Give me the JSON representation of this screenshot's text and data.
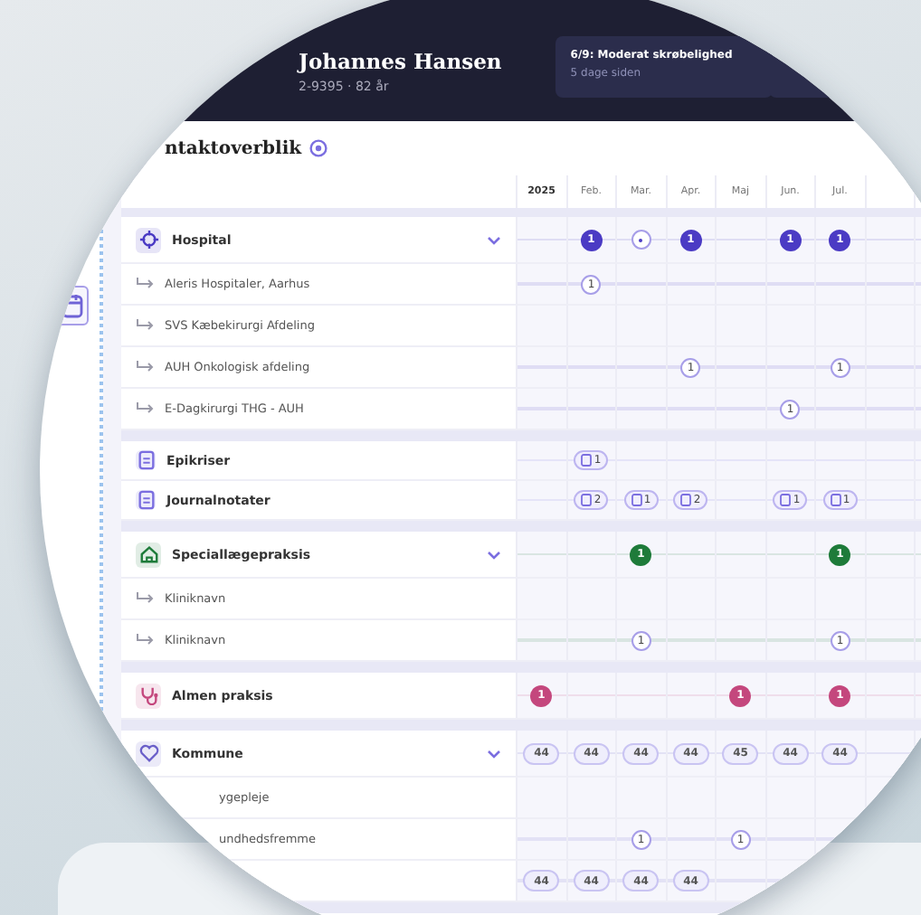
{
  "patient": {
    "name": "Johannes Hansen",
    "details": "2-9395 · 82 år"
  },
  "alert": {
    "title": "6/9: Moderat skrøbelighed",
    "subtitle": "5 dage siden"
  },
  "overview": {
    "title": "ntaktoverblik"
  },
  "months": [
    "2025",
    "Feb.",
    "Mar.",
    "Apr.",
    "Maj",
    "Jun.",
    "Jul."
  ],
  "sections": [
    {
      "color": "#4b3bc4",
      "rows": [
        {
          "kind": "group",
          "label": "Hospital",
          "expanded": true,
          "cells": [
            null,
            {
              "kind": "filled",
              "text": "1"
            },
            {
              "kind": "dot"
            },
            {
              "kind": "filled",
              "text": "1"
            },
            null,
            {
              "kind": "filled",
              "text": "1"
            },
            {
              "kind": "filled",
              "text": "1"
            }
          ]
        },
        {
          "kind": "sub",
          "label": "Aleris Hospitaler, Aarhus",
          "cells": [
            null,
            {
              "kind": "outline",
              "text": "1"
            },
            null,
            null,
            null,
            null,
            null
          ]
        },
        {
          "kind": "sub",
          "label": "SVS Kæbekirurgi Afdeling",
          "cells": []
        },
        {
          "kind": "sub",
          "label": "AUH Onkologisk afdeling",
          "cells": [
            null,
            null,
            null,
            {
              "kind": "outline",
              "text": "1"
            },
            null,
            null,
            {
              "kind": "outline",
              "text": "1"
            }
          ]
        },
        {
          "kind": "sub",
          "label": "E-Dagkirurgi THG - AUH",
          "cells": [
            null,
            null,
            null,
            null,
            null,
            {
              "kind": "outline",
              "text": "1"
            },
            null
          ]
        }
      ]
    },
    {
      "color": "#7b6ee0",
      "rows": [
        {
          "kind": "doc",
          "label": "Epikriser",
          "cells": [
            null,
            {
              "kind": "doc",
              "text": "1"
            },
            null,
            null,
            null,
            null,
            null
          ]
        },
        {
          "kind": "doc",
          "label": "Journalnotater",
          "cells": [
            null,
            {
              "kind": "doc",
              "text": "2"
            },
            {
              "kind": "doc",
              "text": "1"
            },
            {
              "kind": "doc",
              "text": "2"
            },
            null,
            {
              "kind": "doc",
              "text": "1"
            },
            {
              "kind": "doc",
              "text": "1"
            }
          ]
        }
      ]
    },
    {
      "color": "#1e7b3a",
      "rows": [
        {
          "kind": "group",
          "label": "Speciallægepraksis",
          "expanded": true,
          "cells": [
            null,
            null,
            {
              "kind": "filled",
              "text": "1"
            },
            null,
            null,
            null,
            {
              "kind": "filled",
              "text": "1"
            }
          ]
        },
        {
          "kind": "sub",
          "label": "Kliniknavn",
          "cells": []
        },
        {
          "kind": "sub",
          "label": "Kliniknavn",
          "cells": [
            null,
            null,
            {
              "kind": "outline",
              "text": "1"
            },
            null,
            null,
            null,
            {
              "kind": "outline",
              "text": "1"
            }
          ]
        }
      ]
    },
    {
      "color": "#c4477d",
      "rows": [
        {
          "kind": "group",
          "label": "Almen praksis",
          "cells": [
            {
              "kind": "filled",
              "text": "1"
            },
            null,
            null,
            null,
            {
              "kind": "filled",
              "text": "1"
            },
            null,
            {
              "kind": "filled",
              "text": "1"
            }
          ]
        }
      ]
    },
    {
      "color": "#6a5fc9",
      "rows": [
        {
          "kind": "group",
          "label": "Kommune",
          "expanded": true,
          "cells": [
            {
              "kind": "pill",
              "text": "44"
            },
            {
              "kind": "pill",
              "text": "44"
            },
            {
              "kind": "pill",
              "text": "44"
            },
            {
              "kind": "pill",
              "text": "44"
            },
            {
              "kind": "pill",
              "text": "45"
            },
            {
              "kind": "pill",
              "text": "44"
            },
            {
              "kind": "pill",
              "text": "44"
            }
          ]
        },
        {
          "kind": "clipped",
          "label": "ygepleje",
          "cells": []
        },
        {
          "kind": "clipped",
          "label": "undhedsfremme",
          "cells": [
            null,
            null,
            {
              "kind": "outline",
              "text": "1"
            },
            null,
            {
              "kind": "outline",
              "text": "1"
            },
            null,
            null
          ]
        },
        {
          "kind": "clipped",
          "cells": [
            {
              "kind": "pill",
              "text": "44"
            },
            {
              "kind": "pill",
              "text": "44"
            },
            {
              "kind": "pill",
              "text": "44"
            },
            {
              "kind": "pill",
              "text": "44"
            },
            null,
            null,
            null
          ]
        }
      ]
    }
  ]
}
